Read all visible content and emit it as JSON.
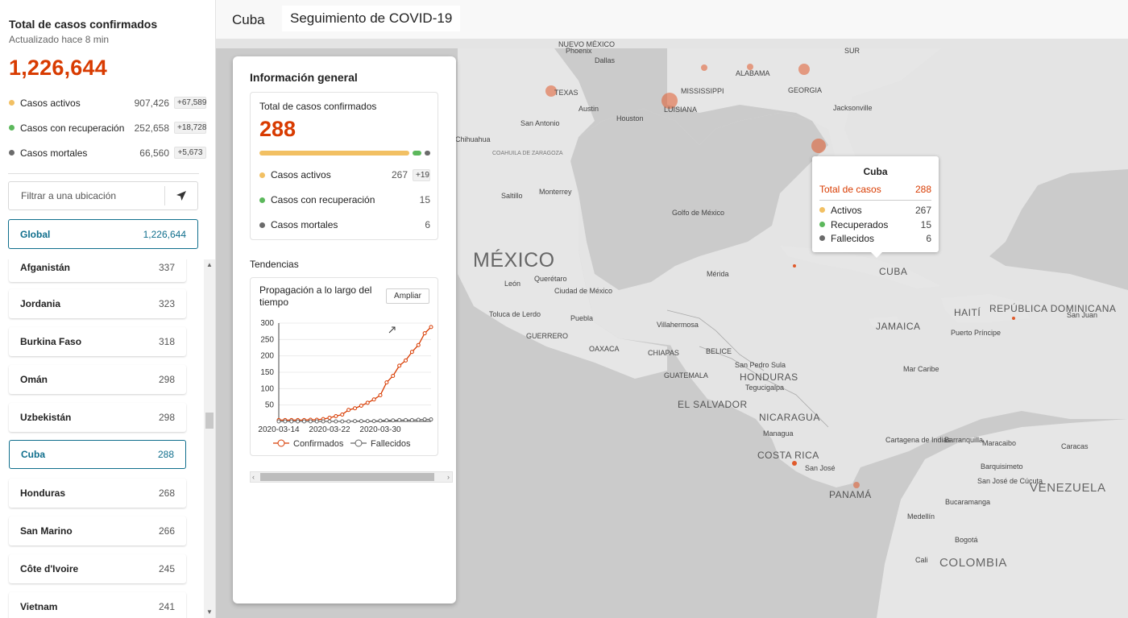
{
  "sidebar": {
    "title": "Total de casos confirmados",
    "updated": "Actualizado hace 8 min",
    "total": "1,226,644",
    "stats": [
      {
        "label": "Casos activos",
        "value": "907,426",
        "delta": "+67,589",
        "color": "#f2c063"
      },
      {
        "label": "Casos con recuperación",
        "value": "252,658",
        "delta": "+18,728",
        "color": "#5cb85c"
      },
      {
        "label": "Casos mortales",
        "value": "66,560",
        "delta": "+5,673",
        "color": "#6b6b6b"
      }
    ],
    "filter_placeholder": "Filtrar a una ubicación",
    "global": {
      "label": "Global",
      "value": "1,226,644"
    },
    "countries": [
      {
        "name": "Afganistán",
        "count": "337"
      },
      {
        "name": "Jordania",
        "count": "323"
      },
      {
        "name": "Burkina Faso",
        "count": "318"
      },
      {
        "name": "Omán",
        "count": "298"
      },
      {
        "name": "Uzbekistán",
        "count": "298"
      },
      {
        "name": "Cuba",
        "count": "288"
      },
      {
        "name": "Honduras",
        "count": "268"
      },
      {
        "name": "San Marino",
        "count": "266"
      },
      {
        "name": "Côte d'Ivoire",
        "count": "245"
      },
      {
        "name": "Vietnam",
        "count": "241"
      }
    ]
  },
  "topbar": {
    "country": "Cuba",
    "title": "Seguimiento de COVID-19"
  },
  "info": {
    "title": "Información general",
    "card_title": "Total de casos confirmados",
    "total": "288",
    "progress": {
      "active": 267,
      "recovered": 15,
      "deaths": 6
    },
    "rows": [
      {
        "label": "Casos activos",
        "value": "267",
        "delta": "+19",
        "color": "#f2c063"
      },
      {
        "label": "Casos con recuperación",
        "value": "15",
        "color": "#5cb85c"
      },
      {
        "label": "Casos mortales",
        "value": "6",
        "color": "#6b6b6b"
      }
    ],
    "trends_label": "Tendencias",
    "chart_title": "Propagación a lo largo del tiempo",
    "expand_label": "Ampliar"
  },
  "chart_data": {
    "type": "line",
    "title": "Propagación a lo largo del tiempo",
    "x_ticks": [
      "2020-03-14",
      "2020-03-22",
      "2020-03-30"
    ],
    "y_ticks": [
      50,
      100,
      150,
      200,
      250,
      300
    ],
    "ylim": [
      0,
      300
    ],
    "series": [
      {
        "name": "Confirmados",
        "color": "#d83b01",
        "values": [
          4,
          4,
          4,
          4,
          4,
          5,
          5,
          7,
          11,
          16,
          21,
          35,
          40,
          48,
          57,
          67,
          80,
          119,
          139,
          170,
          186,
          212,
          233,
          269,
          288
        ]
      },
      {
        "name": "Fallecidos",
        "color": "#666666",
        "values": [
          0,
          0,
          0,
          0,
          0,
          0,
          0,
          0,
          0,
          0,
          0,
          0,
          1,
          1,
          1,
          1,
          2,
          3,
          3,
          4,
          4,
          4,
          5,
          6,
          6
        ]
      }
    ]
  },
  "tooltip": {
    "title": "Cuba",
    "total_label": "Total de casos",
    "total_value": "288",
    "rows": [
      {
        "label": "Activos",
        "value": "267",
        "color": "#f2c063"
      },
      {
        "label": "Recuperados",
        "value": "15",
        "color": "#5cb85c"
      },
      {
        "label": "Fallecidos",
        "value": "6",
        "color": "#6b6b6b"
      }
    ]
  },
  "map_labels": [
    {
      "text": "NUEVO MÉXICO"
    },
    {
      "text": "Phoenix"
    },
    {
      "text": "Dallas"
    },
    {
      "text": "TEXAS"
    },
    {
      "text": "Austin"
    },
    {
      "text": "Houston"
    },
    {
      "text": "San Antonio"
    },
    {
      "text": "LUISIANA"
    },
    {
      "text": "MISSISSIPPI"
    },
    {
      "text": "ALABAMA"
    },
    {
      "text": "GEORGIA"
    },
    {
      "text": "Jacksonville"
    },
    {
      "text": "SUR"
    },
    {
      "text": "Chihuahua"
    },
    {
      "text": "COAHUILA DE ZARAGOZA"
    },
    {
      "text": "Saltillo"
    },
    {
      "text": "Monterrey"
    },
    {
      "text": "Golfo de México"
    },
    {
      "text": "MÉXICO"
    },
    {
      "text": "León"
    },
    {
      "text": "Querétaro"
    },
    {
      "text": "Ciudad de México"
    },
    {
      "text": "Toluca de Lerdo"
    },
    {
      "text": "Puebla"
    },
    {
      "text": "OAXACA"
    },
    {
      "text": "GUERRERO"
    },
    {
      "text": "Villahermosa"
    },
    {
      "text": "Mérida"
    },
    {
      "text": "CHIAPAS"
    },
    {
      "text": "BELICE"
    },
    {
      "text": "GUATEMALA"
    },
    {
      "text": "San Pedro Sula"
    },
    {
      "text": "HONDURAS"
    },
    {
      "text": "Tegucigalpa"
    },
    {
      "text": "EL SALVADOR"
    },
    {
      "text": "NICARAGUA"
    },
    {
      "text": "Managua"
    },
    {
      "text": "COSTA RICA"
    },
    {
      "text": "San José"
    },
    {
      "text": "PANAMÁ"
    },
    {
      "text": "CUBA"
    },
    {
      "text": "JAMAICA"
    },
    {
      "text": "HAITÍ"
    },
    {
      "text": "REPÚBLICA DOMINICANA"
    },
    {
      "text": "Puerto Príncipe"
    },
    {
      "text": "San Juan"
    },
    {
      "text": "Mar Caribe"
    },
    {
      "text": "Cartagena de Indias"
    },
    {
      "text": "Barranquilla"
    },
    {
      "text": "Maracaibo"
    },
    {
      "text": "Caracas"
    },
    {
      "text": "Barquisimeto"
    },
    {
      "text": "San José de Cúcuta"
    },
    {
      "text": "VENEZUELA"
    },
    {
      "text": "Bucaramanga"
    },
    {
      "text": "Medellín"
    },
    {
      "text": "Bogotá"
    },
    {
      "text": "Cali"
    },
    {
      "text": "COLOMBIA"
    }
  ]
}
